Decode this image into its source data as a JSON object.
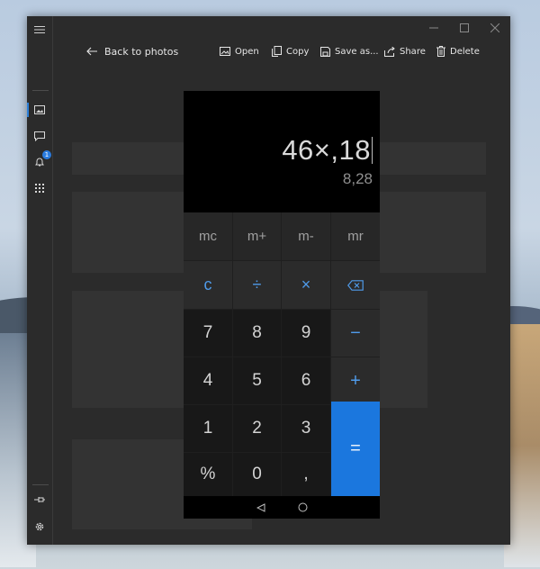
{
  "app": {
    "back_label": "Back to photos",
    "actions": [
      {
        "label": "Open",
        "icon": "image-open-icon"
      },
      {
        "label": "Copy",
        "icon": "copy-icon"
      },
      {
        "label": "Save as...",
        "icon": "save-icon"
      },
      {
        "label": "Share",
        "icon": "share-icon"
      },
      {
        "label": "Delete",
        "icon": "delete-icon"
      }
    ],
    "notification_count": "1",
    "accent_color": "#1b77de"
  },
  "calculator": {
    "expression": "46×,18",
    "result": "8,28",
    "memory_keys": [
      "mc",
      "m+",
      "m-",
      "mr"
    ],
    "operator_row": [
      "c",
      "÷",
      "×",
      "⌫"
    ],
    "digits": [
      "7",
      "8",
      "9",
      "4",
      "5",
      "6",
      "1",
      "2",
      "3",
      "%",
      "0",
      ","
    ],
    "side_ops": [
      "−",
      "+",
      "="
    ]
  }
}
